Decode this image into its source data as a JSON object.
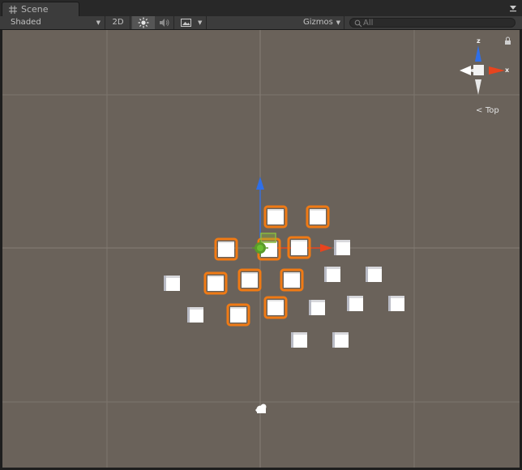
{
  "tab": {
    "label": "Scene",
    "icon": "grid-icon"
  },
  "toolbar": {
    "shading_mode": "Shaded",
    "mode_2d": "2D",
    "lighting_icon": "sun-icon",
    "audio_icon": "speaker-icon",
    "effects_icon": "image-icon",
    "gizmos_label": "Gizmos",
    "search_placeholder": "All"
  },
  "scene_gizmo": {
    "axes": [
      "z",
      "x"
    ],
    "view_label": "Top",
    "colors": {
      "x": "#e8441e",
      "z": "#2f6fe8",
      "y": "#ffffff"
    }
  },
  "objects": {
    "selected_outline_color": "#f07a14",
    "cube_color": "#ffffff",
    "background_color": "#6a625a"
  }
}
